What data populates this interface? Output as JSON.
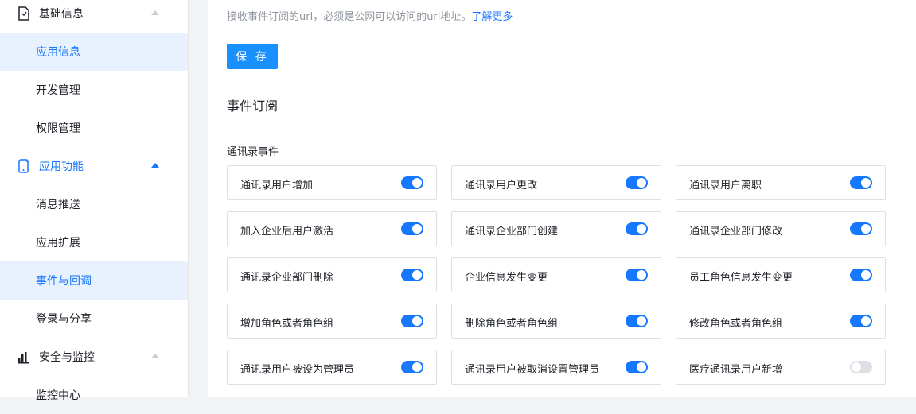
{
  "sidebar": {
    "groups": [
      {
        "label": "基础信息",
        "icon": "document-icon",
        "expanded": false
      },
      {
        "label": "应用功能",
        "icon": "phone-icon",
        "expanded": true
      },
      {
        "label": "安全与监控",
        "icon": "bar-chart-icon",
        "expanded": false
      }
    ],
    "items": [
      {
        "label": "应用信息",
        "active": true
      },
      {
        "label": "开发管理",
        "active": false
      },
      {
        "label": "权限管理",
        "active": false
      },
      {
        "label": "消息推送",
        "active": false
      },
      {
        "label": "应用扩展",
        "active": false
      },
      {
        "label": "事件与回调",
        "active": true
      },
      {
        "label": "登录与分享",
        "active": false
      },
      {
        "label": "监控中心",
        "active": false
      }
    ]
  },
  "main": {
    "hint_text": "接收事件订阅的url，必须是公网可以访问的url地址。",
    "hint_link": "了解更多",
    "save_label": "保 存",
    "section_title": "事件订阅",
    "subsection_title": "通讯录事件",
    "events": [
      {
        "label": "通讯录用户增加",
        "enabled": true
      },
      {
        "label": "通讯录用户更改",
        "enabled": true
      },
      {
        "label": "通讯录用户离职",
        "enabled": true
      },
      {
        "label": "加入企业后用户激活",
        "enabled": true
      },
      {
        "label": "通讯录企业部门创建",
        "enabled": true
      },
      {
        "label": "通讯录企业部门修改",
        "enabled": true
      },
      {
        "label": "通讯录企业部门删除",
        "enabled": true
      },
      {
        "label": "企业信息发生变更",
        "enabled": true
      },
      {
        "label": "员工角色信息发生变更",
        "enabled": true
      },
      {
        "label": "增加角色或者角色组",
        "enabled": true
      },
      {
        "label": "删除角色或者角色组",
        "enabled": true
      },
      {
        "label": "修改角色或者角色组",
        "enabled": true
      },
      {
        "label": "通讯录用户被设为管理员",
        "enabled": true
      },
      {
        "label": "通讯录用户被取消设置管理员",
        "enabled": true
      },
      {
        "label": "医疗通讯录用户新增",
        "enabled": false
      }
    ]
  },
  "colors": {
    "accent": "#1677ff",
    "active_bg": "#e8f1fe",
    "toggle_off": "#dcdfe4"
  }
}
